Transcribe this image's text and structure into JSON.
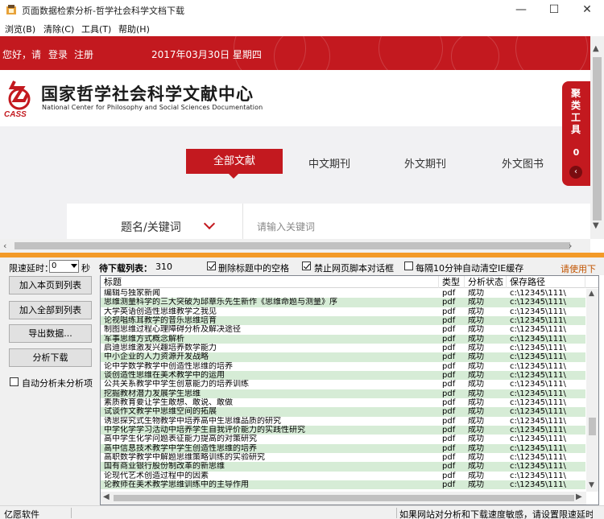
{
  "window": {
    "title": "页面数据检索分析-哲学社会科学文档下载",
    "minimize": "—",
    "maximize": "☐",
    "close": "✕"
  },
  "menu": [
    "浏览(B)",
    "清除(C)",
    "工具(T)",
    "帮助(H)"
  ],
  "web": {
    "greeting": "您好，请",
    "login": "登录",
    "register": "注册",
    "date": "2017年03月30日 星期四",
    "logo_cn": "国家哲学社会科学文献中心",
    "logo_en": "National Center for Philosophy and Social Sciences Documentation",
    "logo_abbr": "CASS",
    "tabs": [
      "全部文献",
      "中文期刊",
      "外文期刊",
      "外文图书"
    ],
    "search_field": "题名/关键词",
    "search_placeholder": "请输入关键词",
    "side_panel": "聚类工具",
    "side_count": "0",
    "side_back": "‹"
  },
  "controls": {
    "delay_label": "限速延时：",
    "delay_value": "0",
    "delay_unit": "秒",
    "queue_label": "待下载列表：",
    "queue_count": "310",
    "opt1": "删除标题中的空格",
    "opt2": "禁止网页脚本对话框",
    "opt3": "每隔10分钟自动清空IE缓存",
    "note": "请使用下"
  },
  "buttons": {
    "add_page": "加入本页到列表",
    "add_all": "加入全部到列表",
    "export": "导出数据...",
    "analyze": "分析下载",
    "auto_label": "自动分析未分析项"
  },
  "table": {
    "headers": [
      "标题",
      "类型",
      "分析状态",
      "保存路径"
    ],
    "rows": [
      [
        "编辑与独家新闻",
        "pdf",
        "成功",
        "c:\\12345\\111\\"
      ],
      [
        "思维测量科学的三大突破为邱章乐先生新作《思维命题与测量》序",
        "pdf",
        "成功",
        "c:\\12345\\111\\"
      ],
      [
        "大学英语创造性思维教学之我见",
        "pdf",
        "成功",
        "c:\\12345\\111\\"
      ],
      [
        "论视唱练耳教学的音乐思维培育",
        "pdf",
        "成功",
        "c:\\12345\\111\\"
      ],
      [
        "制图思维过程心理障碍分析及解决途径",
        "pdf",
        "成功",
        "c:\\12345\\111\\"
      ],
      [
        "军事思维方式概念解析",
        "pdf",
        "成功",
        "c:\\12345\\111\\"
      ],
      [
        "启迪思维激发兴趣培养数学能力",
        "pdf",
        "成功",
        "c:\\12345\\111\\"
      ],
      [
        "中小企业的人力资源开发战略",
        "pdf",
        "成功",
        "c:\\12345\\111\\"
      ],
      [
        "论中学数学教学中创造性思维的培养",
        "pdf",
        "成功",
        "c:\\12345\\111\\"
      ],
      [
        "谈创造性思维在美术教学中的运用",
        "pdf",
        "成功",
        "c:\\12345\\111\\"
      ],
      [
        "公共关系教学中学生创意能力的培养训练",
        "pdf",
        "成功",
        "c:\\12345\\111\\"
      ],
      [
        "挖掘教材潜力发展学生思维",
        "pdf",
        "成功",
        "c:\\12345\\111\\"
      ],
      [
        "素质教育要让学生敢想、敢说、敢做",
        "pdf",
        "成功",
        "c:\\12345\\111\\"
      ],
      [
        "试谈作文教学中思维空间的拓展",
        "pdf",
        "成功",
        "c:\\12345\\111\\"
      ],
      [
        "诱思探究式生物教学中培养高中生思维品质的研究",
        "pdf",
        "成功",
        "c:\\12345\\111\\"
      ],
      [
        "中学化学学习活动中培养学生自我评价能力的实践性研究",
        "pdf",
        "成功",
        "c:\\12345\\111\\"
      ],
      [
        "高中学生化学问题表征能力提高的对策研究",
        "pdf",
        "成功",
        "c:\\12345\\111\\"
      ],
      [
        "高中信息技术教学中学生创造性思维的培养",
        "pdf",
        "成功",
        "c:\\12345\\111\\"
      ],
      [
        "高职数学教学中解题思维策略训练的实验研究",
        "pdf",
        "成功",
        "c:\\12345\\111\\"
      ],
      [
        "国有商业银行股份制改革的新思维",
        "pdf",
        "成功",
        "c:\\12345\\111\\"
      ],
      [
        "论现代艺术创造过程中的因素",
        "pdf",
        "成功",
        "c:\\12345\\111\\"
      ],
      [
        "论教师在美术教学思维训练中的主导作用",
        "pdf",
        "成功",
        "c:\\12345\\111\\"
      ]
    ]
  },
  "status": {
    "left": "亿愿软件",
    "right": "如果网站对分析和下载速度敏感，请设置限速延时"
  }
}
